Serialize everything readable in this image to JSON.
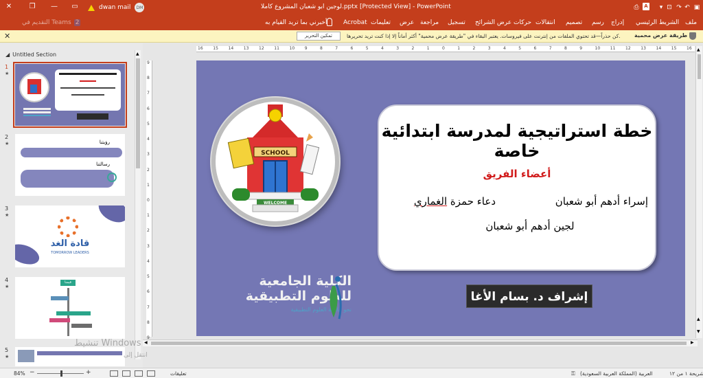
{
  "titlebar": {
    "title": "لوجين ابو شعبان المشروع كاملا.pptx [Protected View] - PowerPoint",
    "user_name": "dwan mail",
    "user_initials": "DM",
    "warning_icon": "warning-icon",
    "controls": [
      "minimize",
      "restore",
      "close"
    ]
  },
  "ribbon": {
    "tabs": [
      "ملف",
      "الشريط الرئيسي",
      "إدراج",
      "رسم",
      "تصميم",
      "انتقالات",
      "حركات",
      "عرض الشرائح",
      "تسجيل",
      "مراجعة",
      "عرض",
      "تعليمات",
      "Acrobat"
    ],
    "tell_me": "أخبرني بما تريد القيام به",
    "teams": "التقديم في Teams",
    "teams_badge": "2"
  },
  "infobar": {
    "title": "طريقة عرض محمية",
    "message": "كن حذراً—قد تحتوي الملفات من إنترنت على فيروسات. يعتبر البقاء في \"طريقة عرض محمية\" أكثر أماناً إلا إذا كنت تريد تحريرها.",
    "enable_button": "تمكين التحرير"
  },
  "panel": {
    "section_title": "Untitled Section",
    "slides": [
      {
        "num": "1",
        "star": "★"
      },
      {
        "num": "2",
        "star": "★"
      },
      {
        "num": "3",
        "star": "★"
      },
      {
        "num": "4",
        "star": "★"
      },
      {
        "num": "5",
        "star": "★"
      }
    ],
    "thumb2": {
      "vision_title": "رؤيتنا",
      "mission_title": "رسالتنا"
    },
    "thumb3": {
      "logo_text": "قادة الغد",
      "logo_en": "TOMORROW LEADERS"
    },
    "thumb4": {
      "label": "قيمنا"
    }
  },
  "slide": {
    "title": "خطة استراتيجية لمدرسة ابتدائية خاصة",
    "team_title": "أعضاء الفريق",
    "member1": "إسراء أدهم أبو شعبان",
    "member2_a": "دعاء حمزة ",
    "member2_b": "الغماري",
    "member3": "لجين أدهم أبو شعبان",
    "supervisor": "إشراف د. بسام الأغا",
    "school_sign": "SCHOOL",
    "welcome": "WELCOME",
    "college_line1": "الكلية الجامعية",
    "college_line2": "للعلوم التطبيقية",
    "college_sub": "نحو جامعة العلوم التطبيقية"
  },
  "ruler": {
    "h_ticks": [
      "16",
      "15",
      "14",
      "13",
      "12",
      "11",
      "10",
      "9",
      "8",
      "7",
      "6",
      "5",
      "4",
      "3",
      "2",
      "1",
      "0",
      "1",
      "2",
      "3",
      "4",
      "5",
      "6",
      "7",
      "8",
      "9",
      "10",
      "11",
      "12",
      "13",
      "14",
      "15",
      "16"
    ],
    "v_ticks": [
      "9",
      "8",
      "7",
      "6",
      "5",
      "4",
      "3",
      "2",
      "1",
      "0",
      "1",
      "2",
      "3",
      "4",
      "5",
      "6",
      "7",
      "8",
      "9"
    ]
  },
  "watermark": {
    "line1": "تنشيط Windows",
    "line2": "انتقل إلى"
  },
  "statusbar": {
    "slide_info": "شريحة ١ من ١٢",
    "language": "العربية (المملكة العربية السعودية)",
    "notes": "ملاحظات",
    "comments": "تعليقات",
    "zoom": "84%"
  }
}
